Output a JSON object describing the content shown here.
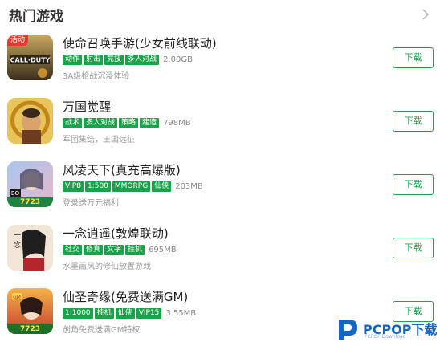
{
  "section": {
    "title": "热门游戏"
  },
  "games": [
    {
      "name": "使命召唤手游(少女前线联动)",
      "ribbon": "活动",
      "icon": "call-of-duty-game-icon",
      "tags": [
        "动作",
        "射击",
        "竞技",
        "多人对战"
      ],
      "size": "2.00GB",
      "desc": "3A级枪战沉浸体验",
      "download_label": "下载"
    },
    {
      "name": "万国觉醒",
      "icon": "rise-of-kingdoms-game-icon",
      "tags": [
        "战术",
        "多人对战",
        "策略",
        "建造"
      ],
      "size": "798MB",
      "desc": "军团集结，王国远征",
      "download_label": "下载"
    },
    {
      "name": "风凌天下(真充高爆版)",
      "icon": "fengling-tianxia-game-icon",
      "tags": [
        "VIP8",
        "1:500",
        "MMORPG",
        "仙侠"
      ],
      "size": "203MB",
      "desc": "登录送万元福利",
      "badge": "7723",
      "download_label": "下载"
    },
    {
      "name": "一念逍遥(敦煌联动)",
      "icon": "yinian-xiaoyao-game-icon",
      "tags": [
        "社交",
        "修真",
        "文字",
        "挂机"
      ],
      "size": "695MB",
      "desc": "水墨画风的修仙放置游戏",
      "download_label": "下载"
    },
    {
      "name": "仙圣奇缘(免费送满GM)",
      "icon": "xiansheng-qiyuan-game-icon",
      "tags": [
        "1:1000",
        "挂机",
        "仙侠",
        "VIP15"
      ],
      "size": "3.55MB",
      "desc": "创角免费送满GM特权",
      "badge": "7723",
      "download_label": "下载"
    }
  ],
  "watermark": {
    "brand": "PCPOP下载",
    "sub": "PCPOP Download"
  },
  "colors": {
    "accent": "#1aa34a",
    "ribbon": "#e53935",
    "watermark": "#1565c0"
  }
}
